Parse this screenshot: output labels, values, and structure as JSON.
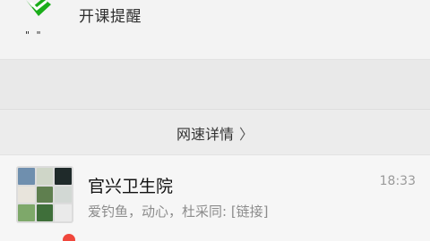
{
  "reminder": {
    "title": "开课提醒",
    "quote_marks": "\" \""
  },
  "network": {
    "link_label": "网速详情",
    "chevron": "〉"
  },
  "chat": {
    "name": "官兴卫生院",
    "time": "18:33",
    "preview": "爱钓鱼，动心，杜采同: [链接]"
  },
  "colors": {
    "accent_green": "#1aad19",
    "badge_red": "#f0473c"
  },
  "icons": {
    "reminder": "green-check-icon",
    "chevron": "chevron-right-icon",
    "group_avatar": "group-avatar-grid"
  }
}
